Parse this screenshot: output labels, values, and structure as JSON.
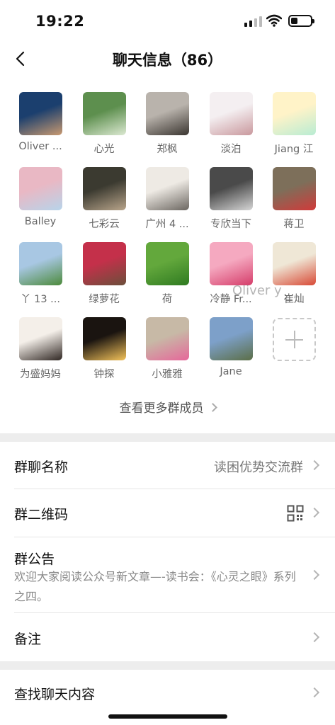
{
  "status": {
    "time": "19:22"
  },
  "nav": {
    "title": "聊天信息（86）"
  },
  "members": [
    {
      "name": "Oliver ...",
      "colors": [
        "#1b3f6e",
        "#c99a70"
      ]
    },
    {
      "name": "心光",
      "colors": [
        "#5d8f4e",
        "#dce9d2"
      ]
    },
    {
      "name": "郑枫",
      "colors": [
        "#b9b3ac",
        "#3a3530"
      ]
    },
    {
      "name": "淡泊",
      "colors": [
        "#f4eff1",
        "#c9989d"
      ]
    },
    {
      "name": "Jiang 江",
      "colors": [
        "#fff3c8",
        "#b8ecd3"
      ]
    },
    {
      "name": "Balley",
      "colors": [
        "#e9b8c4",
        "#b7d4ea"
      ]
    },
    {
      "name": "七彩云",
      "colors": [
        "#3b3a30",
        "#b9a58b"
      ]
    },
    {
      "name": "广州 4 ...",
      "colors": [
        "#eeeae4",
        "#6b6660"
      ]
    },
    {
      "name": "专欣当下",
      "colors": [
        "#4a4a4a",
        "#d6d6d6"
      ]
    },
    {
      "name": "蒋卫",
      "colors": [
        "#7d6f5a",
        "#d13a3a"
      ]
    },
    {
      "name": "丫 13 ...",
      "colors": [
        "#a8c7e3",
        "#4c8a3b"
      ]
    },
    {
      "name": "绿萝花",
      "colors": [
        "#c4304a",
        "#6b4f3b"
      ]
    },
    {
      "name": "荷",
      "colors": [
        "#63a83c",
        "#2f7a21"
      ]
    },
    {
      "name": "冷静 Fr...",
      "colors": [
        "#f5a9c0",
        "#d53d6a"
      ]
    },
    {
      "name": "崔灿",
      "colors": [
        "#efe7d6",
        "#d84a36"
      ]
    },
    {
      "name": "为盛妈妈",
      "colors": [
        "#f4efe9",
        "#2f2622"
      ]
    },
    {
      "name": "钟探",
      "colors": [
        "#1a1410",
        "#f4c35a"
      ]
    },
    {
      "name": "小雅雅",
      "colors": [
        "#c7b9a6",
        "#e6679a"
      ]
    },
    {
      "name": "Jane",
      "colors": [
        "#7da0c9",
        "#5b6e47"
      ]
    }
  ],
  "watermark": "Oliver y",
  "more_members": "查看更多群成员",
  "settings": {
    "group_name_label": "群聊名称",
    "group_name_value": "读困优势交流群",
    "qr_label": "群二维码",
    "notice_label": "群公告",
    "notice_text": "欢迎大家阅读公众号新文章—-读书会：《心灵之眼》系列之四。",
    "remark_label": "备注",
    "search_label": "查找聊天内容"
  }
}
